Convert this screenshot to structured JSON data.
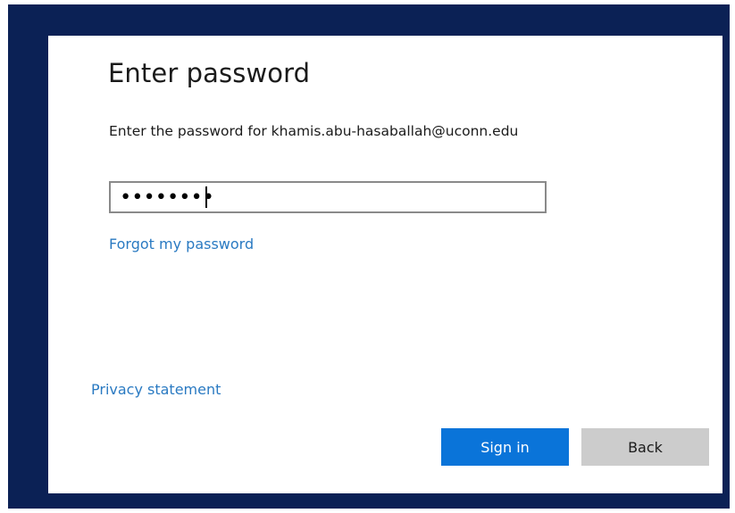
{
  "dialog": {
    "title": "Enter password",
    "description": "Enter the password for khamis.abu-hasaballah@uconn.edu",
    "password_value": "••••••••",
    "forgot_link": "Forgot my password",
    "privacy_link": "Privacy statement",
    "signin_label": "Sign in",
    "back_label": "Back"
  },
  "colors": {
    "frame": "#0b2155",
    "link": "#2a7ac2",
    "primary_button": "#0a74d9",
    "secondary_button": "#cccccc"
  }
}
